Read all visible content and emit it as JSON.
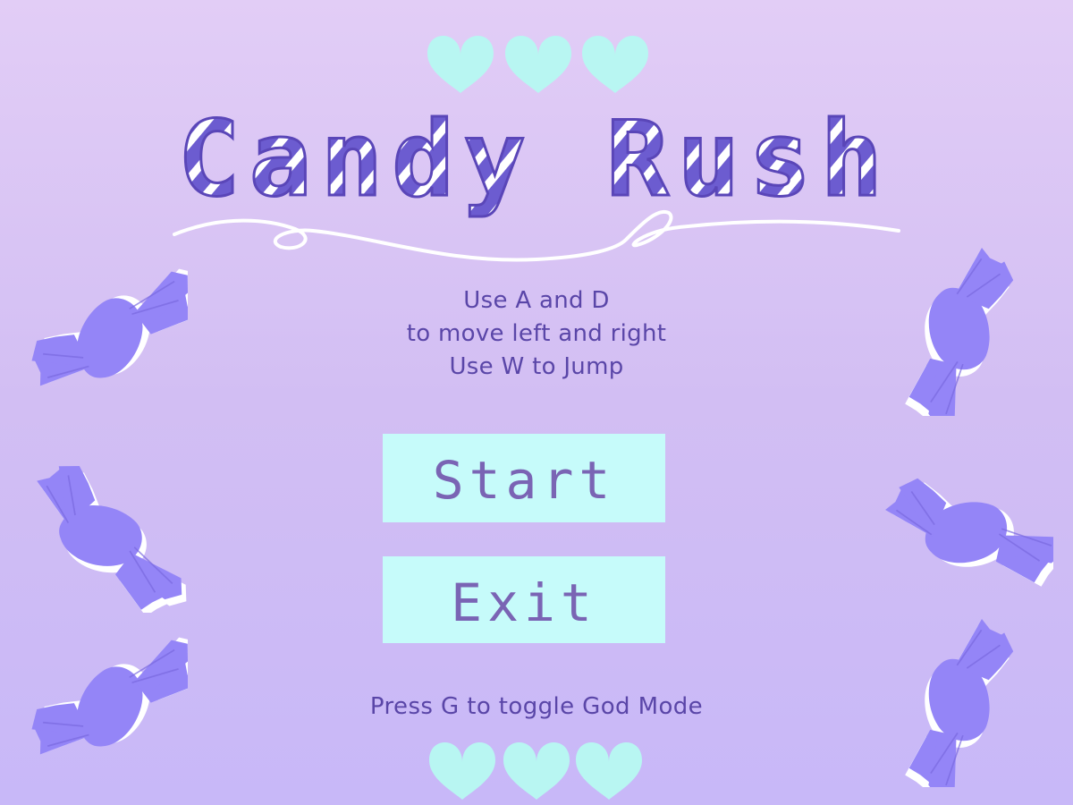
{
  "title": "Candy Rush",
  "instructions": {
    "line1": "Use A and D",
    "line2": "to move left and right",
    "line3": "Use W to Jump"
  },
  "menu": {
    "start_label": "Start",
    "exit_label": "Exit"
  },
  "footer_hint": "Press G to toggle God Mode",
  "icons": {
    "hearts": "heart-icon",
    "candies": "wrapped-candy-icon"
  },
  "colors": {
    "background_top": "#e2cdf6",
    "background_bottom": "#c8b8f8",
    "title_stripe_dark": "#6c5cd0",
    "title_stripe_light": "#ffffff",
    "text": "#5a46a8",
    "button_bg": "#c6fbfa",
    "button_text": "#7a64b4",
    "heart": "#b8f6f2",
    "candy": "#9485f7"
  }
}
